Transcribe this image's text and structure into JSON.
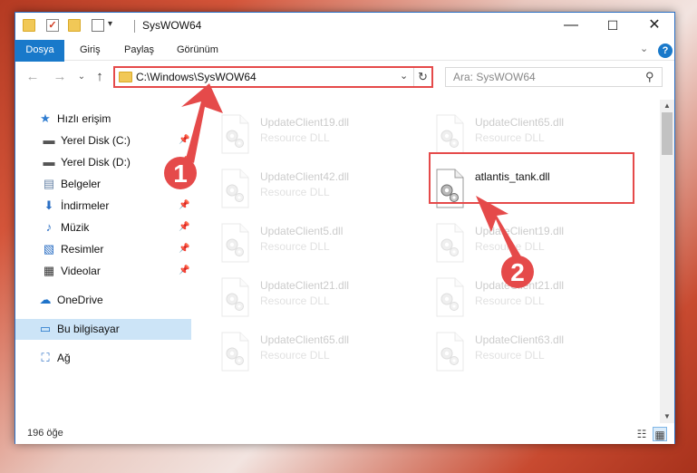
{
  "window": {
    "title": "SysWOW64",
    "controls": {
      "minimize": "—",
      "maximize": "☐",
      "close": "✕"
    }
  },
  "ribbon": {
    "tabs": [
      "Dosya",
      "Giriş",
      "Paylaş",
      "Görünüm"
    ],
    "help": "?",
    "collapse": "⌄"
  },
  "nav": {
    "back": "←",
    "forward": "→",
    "recent": "⌄",
    "up": "↑",
    "address": "C:\\Windows\\SysWOW64",
    "address_dropdown": "⌄",
    "refresh": "↻",
    "search_placeholder": "Ara: SysWOW64",
    "search_icon": "⚲"
  },
  "sidebar": {
    "items": [
      {
        "label": "Hızlı erişim",
        "icon": "★",
        "pinned": false
      },
      {
        "label": "Yerel Disk (C:)",
        "icon": "▬",
        "pinned": true
      },
      {
        "label": "Yerel Disk (D:)",
        "icon": "▬",
        "pinned": true
      },
      {
        "label": "Belgeler",
        "icon": "▤",
        "pinned": true
      },
      {
        "label": "İndirmeler",
        "icon": "⬇",
        "pinned": true
      },
      {
        "label": "Müzik",
        "icon": "♪",
        "pinned": true
      },
      {
        "label": "Resimler",
        "icon": "▧",
        "pinned": true
      },
      {
        "label": "Videolar",
        "icon": "▦",
        "pinned": true
      },
      {
        "label": "OneDrive",
        "icon": "☁",
        "pinned": false
      },
      {
        "label": "Bu bilgisayar",
        "icon": "▭",
        "pinned": false
      },
      {
        "label": "Ağ",
        "icon": "⛶",
        "pinned": false
      }
    ],
    "pin_icon": "📌"
  },
  "files": [
    {
      "name": "UpdateClient19.dll",
      "type": "Resource DLL",
      "faded": true
    },
    {
      "name": "UpdateClient65.dll",
      "type": "Resource DLL",
      "faded": true
    },
    {
      "name": "UpdateClient42.dll",
      "type": "Resource DLL",
      "faded": true
    },
    {
      "name": "atlantis_tank.dll",
      "type": "",
      "faded": false
    },
    {
      "name": "UpdateClient5.dll",
      "type": "Resource DLL",
      "faded": true
    },
    {
      "name": "UpdateClient19.dll",
      "type": "Resource DLL",
      "faded": true
    },
    {
      "name": "UpdateClient21.dll",
      "type": "Resource DLL",
      "faded": true
    },
    {
      "name": "UpdateClient21.dll",
      "type": "Resource DLL",
      "faded": true
    },
    {
      "name": "UpdateClient65.dll",
      "type": "Resource DLL",
      "faded": true
    },
    {
      "name": "UpdateClient63.dll",
      "type": "Resource DLL",
      "faded": true
    }
  ],
  "status": {
    "count": "196 öğe",
    "view_details": "☷",
    "view_icons": "▦"
  },
  "callouts": [
    "1",
    "2"
  ],
  "colors": {
    "accent": "#1979ca",
    "highlight": "#e54a4a",
    "selected": "#cce4f7"
  }
}
